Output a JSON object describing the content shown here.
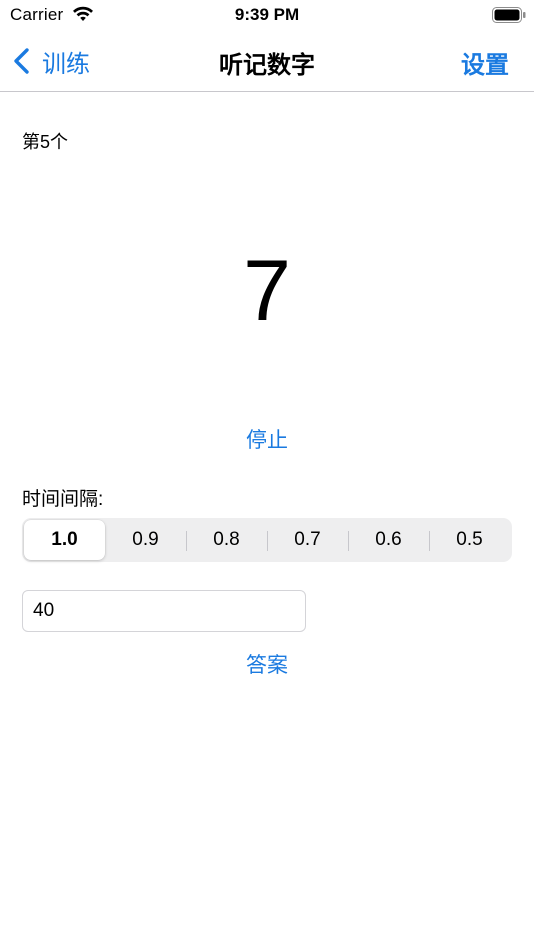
{
  "status_bar": {
    "carrier": "Carrier",
    "time": "9:39 PM",
    "wifi_icon": "wifi-icon",
    "battery_icon": "battery-icon"
  },
  "nav": {
    "back_label": "训练",
    "back_icon": "chevron-left-icon",
    "title": "听记数字",
    "settings_label": "设置"
  },
  "main": {
    "counter": "第5个",
    "current_number": "7",
    "stop_label": "停止",
    "interval_label": "时间间隔:",
    "interval_options": [
      "1.0",
      "0.9",
      "0.8",
      "0.7",
      "0.6",
      "0.5"
    ],
    "selected_interval": "1.0",
    "answer_value": "40",
    "answer_button_label": "答案"
  },
  "colors": {
    "accent": "#1a7ae0",
    "segment_bg": "#eeeeef",
    "divider": "#c8c7cc"
  }
}
